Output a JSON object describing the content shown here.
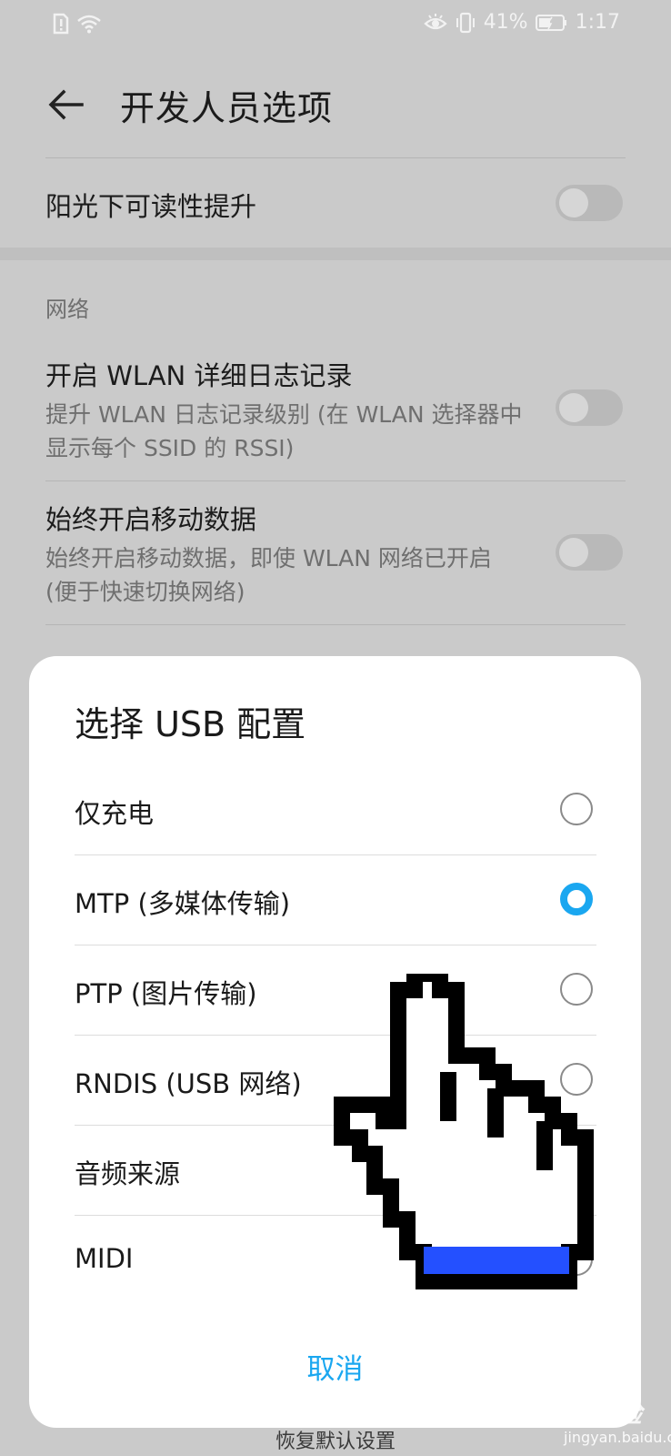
{
  "status_bar": {
    "battery_text": "41%",
    "time": "1:17"
  },
  "header": {
    "title": "开发人员选项"
  },
  "settings": {
    "sunlight": {
      "title": "阳光下可读性提升",
      "enabled": false
    },
    "network_section_label": "网络",
    "wlan_log": {
      "title": "开启 WLAN 详细日志记录",
      "subtitle": "提升 WLAN 日志记录级别 (在 WLAN 选择器中显示每个 SSID 的 RSSI)",
      "enabled": false
    },
    "mobile_data": {
      "title": "始终开启移动数据",
      "subtitle": "始终开启移动数据，即使 WLAN 网络已开启 (便于快速切换网络)",
      "enabled": false
    }
  },
  "dialog": {
    "title": "选择 USB 配置",
    "options": [
      {
        "label": "仅充电",
        "selected": false
      },
      {
        "label": "MTP (多媒体传输)",
        "selected": true
      },
      {
        "label": "PTP (图片传输)",
        "selected": false
      },
      {
        "label": "RNDIS (USB 网络)",
        "selected": false
      },
      {
        "label": "音频来源",
        "selected": false
      },
      {
        "label": "MIDI",
        "selected": false
      }
    ],
    "cancel_label": "取消"
  },
  "bottom_peek_text": "恢复默认设置",
  "watermark": {
    "brand": "Baidu经验",
    "url": "jingyan.baidu.com"
  },
  "colors": {
    "accent": "#1aa7f0",
    "cursor_band": "#2450ff"
  }
}
